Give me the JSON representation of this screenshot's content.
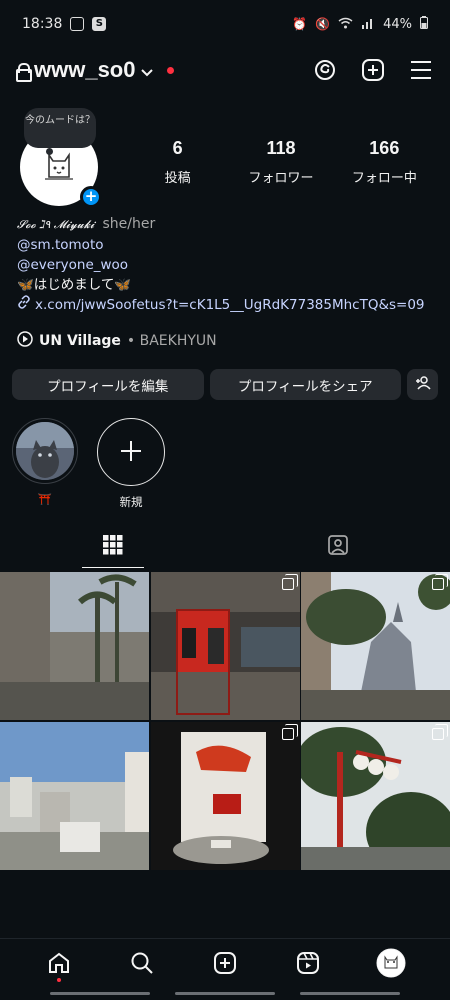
{
  "status_bar": {
    "time": "18:38",
    "battery": "44%"
  },
  "header": {
    "username": "www_so0"
  },
  "profile": {
    "note": "今のムードは？",
    "stats": [
      {
        "num": "6",
        "label": "投稿"
      },
      {
        "num": "118",
        "label": "フォロワー"
      },
      {
        "num": "166",
        "label": "フォロー中"
      }
    ],
    "display_name": "𝓢𝓸𝓸 ℷ٩ 𝓜𝓲𝔂𝓾𝓴𝓲",
    "pronouns": "she/her",
    "bio_lines": [
      "@sm.tomoto",
      "@everyone_woo",
      "🦋はじめまして🦋"
    ],
    "link": "x.com/jwwSoofetus?t=cK1L5__UgRdK77385MhcTQ&s=09",
    "music_song": "UN Village",
    "music_artist": "• BAEKHYUN"
  },
  "buttons": {
    "edit_profile": "プロフィールを編集",
    "share_profile": "プロフィールをシェア"
  },
  "highlights": [
    {
      "label": "⛩️"
    },
    {
      "label": "新規"
    }
  ],
  "colors": {
    "background": "#0b1014",
    "button": "#262a2f",
    "accent_blue": "#0095f6",
    "link": "#c7d4ff",
    "notification_red": "#ff3040"
  }
}
